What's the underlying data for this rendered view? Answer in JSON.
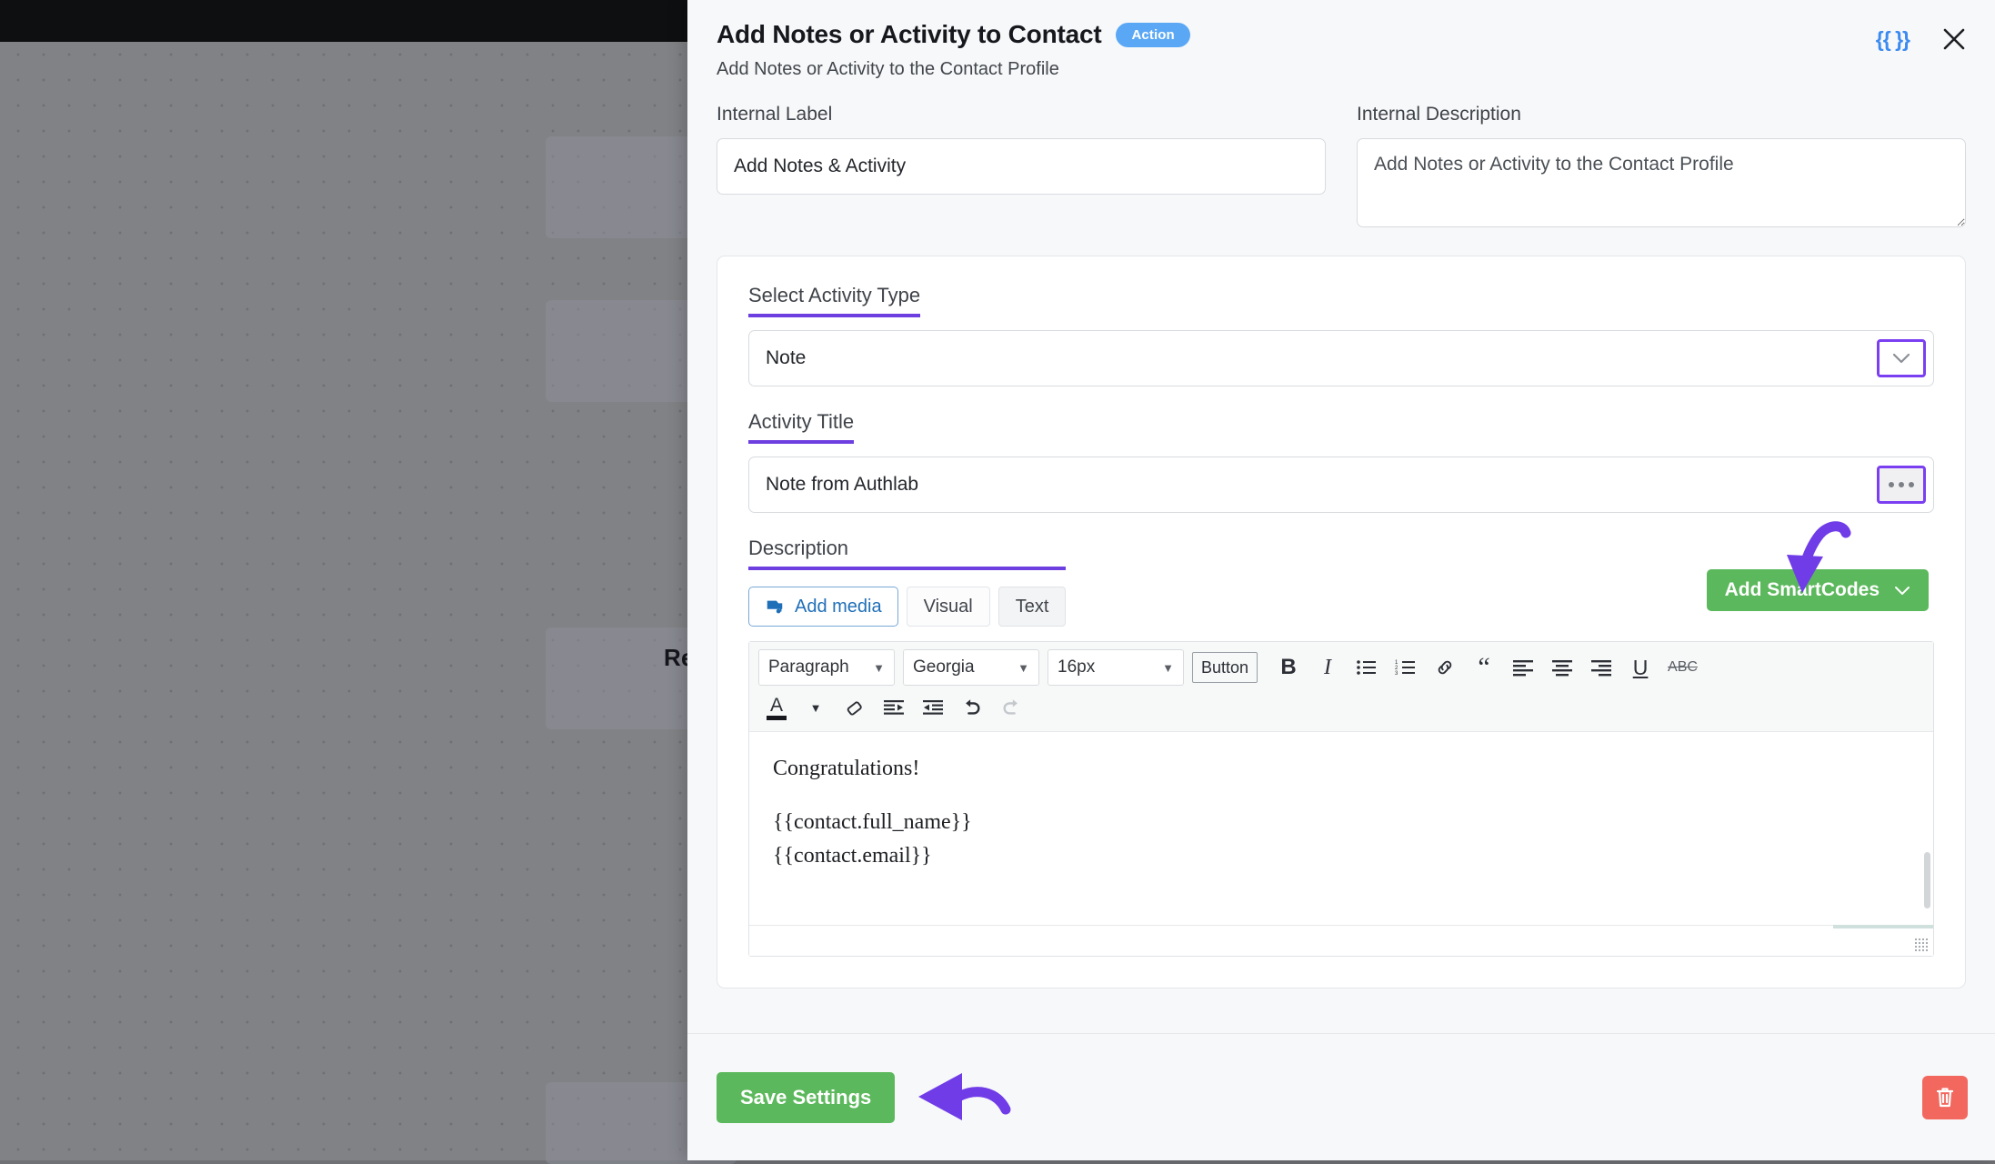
{
  "backdrop": {
    "partial_card_text": "Re"
  },
  "header": {
    "title": "Add Notes or Activity to Contact",
    "badge": "Action",
    "subtitle": "Add Notes or Activity to the Contact Profile",
    "smartcode_token": "{{ }}",
    "close_icon": "close-icon"
  },
  "fields": {
    "internal_label": {
      "label": "Internal Label",
      "value": "Add Notes & Activity"
    },
    "internal_description": {
      "label": "Internal Description",
      "value": "Add Notes or Activity to the Contact Profile"
    }
  },
  "activity": {
    "type_label": "Select Activity Type",
    "type_value": "Note",
    "title_label": "Activity Title",
    "title_value": "Note from Authlab"
  },
  "description": {
    "label": "Description",
    "add_media": "Add media",
    "tabs": [
      {
        "label": "Visual",
        "active": true
      },
      {
        "label": "Text",
        "active": false
      }
    ],
    "add_smartcodes": "Add SmartCodes"
  },
  "editor": {
    "toolbar": {
      "format_block": "Paragraph",
      "font_family": "Georgia",
      "font_size": "16px",
      "button_label": "Button",
      "bold": "B",
      "italic": "I",
      "bullet_list": "bullet-list-icon",
      "numbered_list": "numbered-list-icon",
      "link": "link-icon",
      "blockquote": "blockquote-icon",
      "align_left": "align-left-icon",
      "align_center": "align-center-icon",
      "align_right": "align-right-icon",
      "underline": "U",
      "strikethrough": "ABC",
      "text_color": "A",
      "clear_formatting": "eraser-icon",
      "indent": "indent-icon",
      "outdent": "outdent-icon",
      "undo": "undo-icon",
      "redo": "redo-icon"
    },
    "content": {
      "line1": "Congratulations!",
      "line2": "{{contact.full_name}}",
      "line3": "{{contact.email}}"
    }
  },
  "footer": {
    "save_label": "Save Settings",
    "delete_icon": "trash-icon"
  },
  "colors": {
    "accent_purple": "#6d3ee0",
    "annotation_purple": "#6f3ce8",
    "green": "#5cb85c",
    "badge_blue": "#5aa8f5",
    "danger_red": "#f2685f",
    "link_blue": "#1f6fb8"
  }
}
